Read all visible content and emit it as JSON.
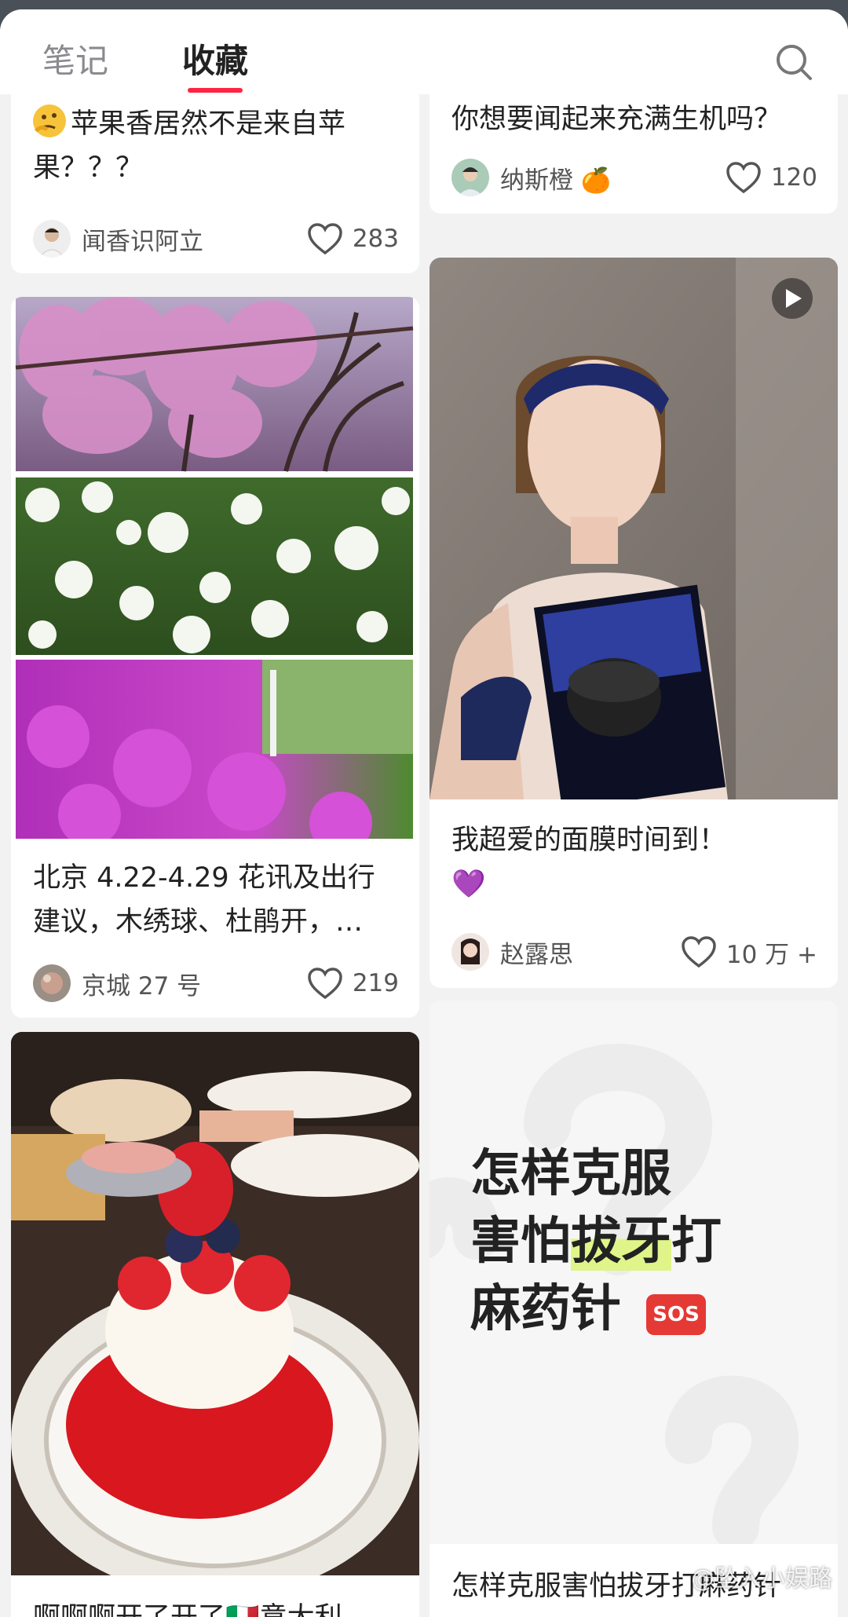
{
  "tabs": [
    "笔记",
    "收藏"
  ],
  "active_tab": "收藏",
  "left": {
    "card1": {
      "title": "苹果香居然不是来自苹果？？？",
      "author": "闻香识阿立",
      "likes": "283"
    },
    "card2": {
      "title": "北京 4.22-4.29 花讯及出行建议，木绣球、杜鹃开，…",
      "author": "京城 27 号",
      "likes": "219"
    },
    "card3": {
      "title": "啊啊啊开了开了🇮🇹意大利"
    }
  },
  "right": {
    "card1": {
      "title": "你想要闻起来充满生机吗？",
      "author": "纳斯橙",
      "author_emoji": "🍊",
      "likes": "120"
    },
    "card2": {
      "title": "我超爱的面膜时间到！",
      "title_emoji": "💜",
      "author": "赵露思",
      "likes": "10 万 +"
    },
    "card3": {
      "cover_lines": [
        "怎样克服",
        "害怕拔牙打",
        "麻药针"
      ],
      "cover_highlight": "拔牙",
      "sos_badge": "SOS",
      "title": "怎样克服害怕拔牙打麻药针"
    }
  },
  "watermark": "@坠入小娱路",
  "colors": {
    "accent": "#ff2442",
    "highlight": "#dff58a",
    "bg": "#f2f2f3"
  }
}
